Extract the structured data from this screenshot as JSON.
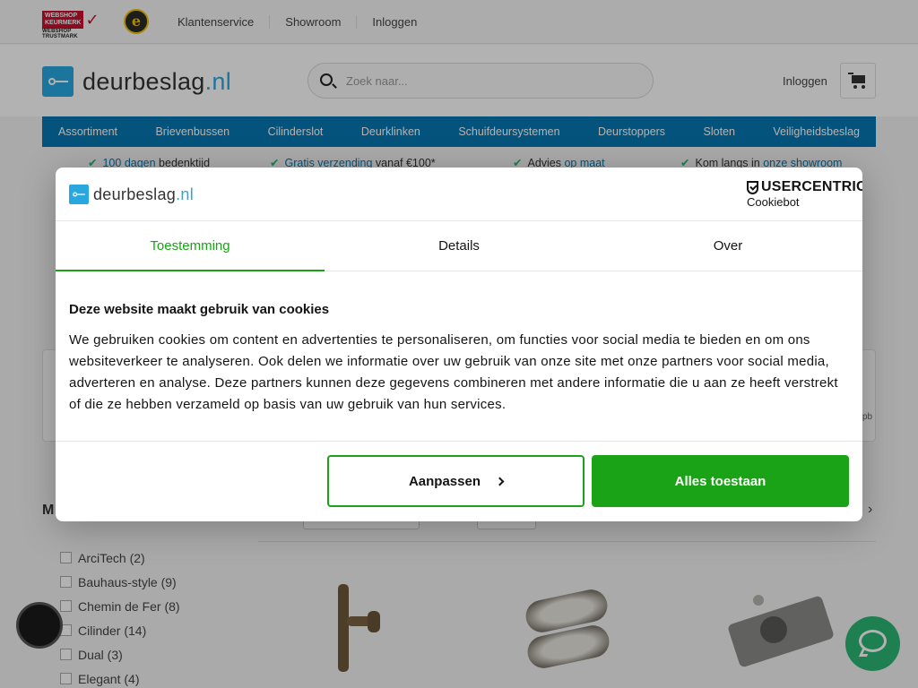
{
  "topbar": {
    "webshop_badge_top": "WEBSHOP",
    "webshop_badge_mid": "KEURMERK",
    "webshop_badge_bottom": "WEBSHOP TRUSTMARK",
    "seal_letter": "e",
    "links": [
      "Klantenservice",
      "Showroom",
      "Inloggen"
    ]
  },
  "header": {
    "logo_name": "deurbeslag",
    "logo_tld": ".nl",
    "search_placeholder": "Zoek naar...",
    "login_label": "Inloggen"
  },
  "nav": {
    "items": [
      "Assortiment",
      "Brievenbussen",
      "Cilinderslot",
      "Deurklinken",
      "Schuifdeursystemen",
      "Deurstoppers",
      "Sloten",
      "Veiligheidsbeslag"
    ]
  },
  "usps": [
    {
      "link": "100 dagen",
      "text": " bedenktijd"
    },
    {
      "link": "Gratis verzending",
      "text": " vanaf €100*"
    },
    {
      "pre": "Advies ",
      "link": "op maat"
    },
    {
      "pre": "Kom langs in ",
      "link": "onze showroom"
    }
  ],
  "background": {
    "strip_tail_text": "pb",
    "sidebar_title_letter": "M",
    "brands": [
      "ArciTech (2)",
      "Bauhaus-style (9)",
      "Chemin de Fer (8)",
      "Cilinder (14)",
      "Dual (3)",
      "Elegant (4)"
    ]
  },
  "cookie_dialog": {
    "logo_name": "deurbeslag",
    "logo_tld": ".nl",
    "provider_name": "USERCENTRICS",
    "provider_sub": "Cookiebot",
    "tabs": [
      "Toestemming",
      "Details",
      "Over"
    ],
    "active_tab": "Toestemming",
    "title": "Deze website maakt gebruik van cookies",
    "body": "We gebruiken cookies om content en advertenties te personaliseren, om functies voor social media te bieden en om ons websiteverkeer te analyseren. Ook delen we informatie over uw gebruik van onze site met onze partners voor social media, adverteren en analyse. Deze partners kunnen deze gegevens combineren met andere informatie die u aan ze heeft verstrekt of die ze hebben verzameld op basis van uw gebruik van hun services.",
    "customize_label": "Aanpassen",
    "allow_all_label": "Alles toestaan"
  },
  "colors": {
    "brand_blue": "#29a8e0",
    "nav_blue": "#0677b2",
    "consent_green": "#1aa316",
    "chat_green": "#2bb673"
  }
}
